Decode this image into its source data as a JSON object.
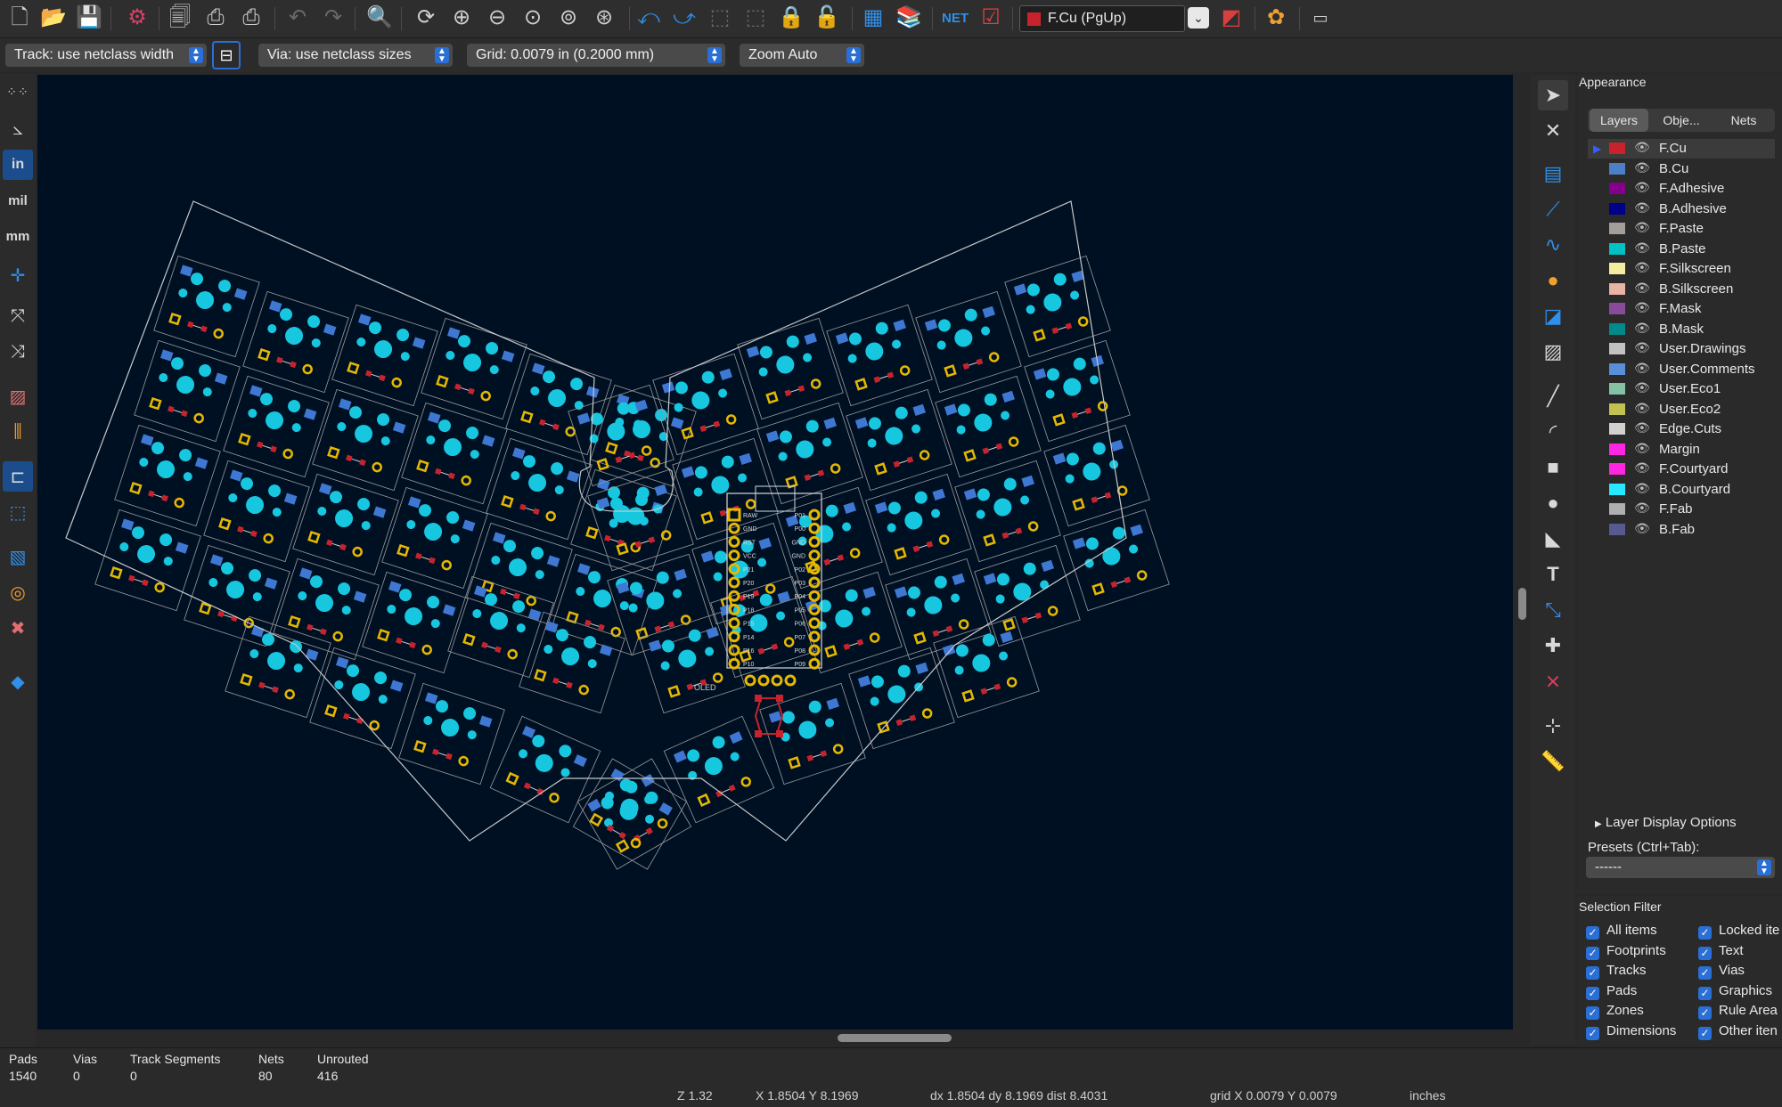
{
  "colors": {
    "canvas_bg": "#001023",
    "pad_cyan": "#17c7e0",
    "pad_blue": "#3f78d3",
    "pad_gold": "#e6b800",
    "pad_red": "#c8232c",
    "edge_cut": "#c8c8c8",
    "accent": "#2a6fd6"
  },
  "top_toolbar": {
    "active_layer": "F.Cu (PgUp)",
    "icons": [
      "new-board-icon",
      "open-icon",
      "save-icon",
      "board-setup-icon",
      "page-settings-icon",
      "print-icon",
      "plot-icon",
      "undo-icon",
      "redo-icon",
      "find-icon",
      "redraw-icon",
      "zoom-in-icon",
      "zoom-out-icon",
      "zoom-fit-icon",
      "zoom-objects-icon",
      "zoom-selection-icon",
      "rotate-ccw-icon",
      "rotate-cw-icon",
      "group-icon",
      "ungroup-icon",
      "lock-icon",
      "unlock-icon",
      "footprint-editor-icon",
      "footprint-library-icon",
      "netlist-icon",
      "drc-icon",
      "layer-pair-icon",
      "scripting-icon",
      "python-console-icon"
    ]
  },
  "sub_toolbar": {
    "track_width": "Track: use netclass width",
    "via_size": "Via: use netclass sizes",
    "grid": "Grid: 0.0079 in (0.2000 mm)",
    "zoom": "Zoom Auto"
  },
  "left_toolbar": {
    "units_in": "in",
    "units_mil": "mil",
    "units_mm": "mm"
  },
  "pcb": {
    "oled_label": "OLED",
    "mcu_left_pins": [
      "RAW",
      "GND",
      "RST",
      "VCC",
      "P21",
      "P20",
      "P19",
      "P18",
      "P15",
      "P14",
      "P16",
      "P10"
    ],
    "mcu_right_pins": [
      "P01",
      "P00",
      "GND",
      "GND",
      "P02",
      "P03",
      "P04",
      "P05",
      "P06",
      "P07",
      "P08",
      "P09"
    ]
  },
  "appearance": {
    "title": "Appearance",
    "tabs": [
      "Layers",
      "Obje...",
      "Nets"
    ],
    "layers": [
      {
        "name": "F.Cu",
        "color": "#c8232c"
      },
      {
        "name": "B.Cu",
        "color": "#4d7fc4"
      },
      {
        "name": "F.Adhesive",
        "color": "#84008a"
      },
      {
        "name": "B.Adhesive",
        "color": "#00008a"
      },
      {
        "name": "F.Paste",
        "color": "#a49e9a"
      },
      {
        "name": "B.Paste",
        "color": "#00c2c2"
      },
      {
        "name": "F.Silkscreen",
        "color": "#f2eda1"
      },
      {
        "name": "B.Silkscreen",
        "color": "#e8b2a7"
      },
      {
        "name": "F.Mask",
        "color": "#8a4a9a"
      },
      {
        "name": "B.Mask",
        "color": "#028a8a"
      },
      {
        "name": "User.Drawings",
        "color": "#c2c2c2"
      },
      {
        "name": "User.Comments",
        "color": "#598fd6"
      },
      {
        "name": "User.Eco1",
        "color": "#85c2a3"
      },
      {
        "name": "User.Eco2",
        "color": "#c2c252"
      },
      {
        "name": "Edge.Cuts",
        "color": "#d0d2cd"
      },
      {
        "name": "Margin",
        "color": "#ff26e2"
      },
      {
        "name": "F.Courtyard",
        "color": "#ff26e2"
      },
      {
        "name": "B.Courtyard",
        "color": "#26e9ff"
      },
      {
        "name": "F.Fab",
        "color": "#afafaf"
      },
      {
        "name": "B.Fab",
        "color": "#58598f"
      }
    ],
    "layer_display_options": "Layer Display Options",
    "presets_label": "Presets (Ctrl+Tab):",
    "presets_value": "------"
  },
  "selection_filter": {
    "title": "Selection Filter",
    "items_left": [
      "All items",
      "Footprints",
      "Tracks",
      "Pads",
      "Zones",
      "Dimensions"
    ],
    "items_right": [
      "Locked ite",
      "Text",
      "Vias",
      "Graphics",
      "Rule Area",
      "Other iten"
    ]
  },
  "status": {
    "pads_label": "Pads",
    "pads": "1540",
    "vias_label": "Vias",
    "vias": "0",
    "tracks_label": "Track Segments",
    "tracks": "0",
    "nets_label": "Nets",
    "nets": "80",
    "unrouted_label": "Unrouted",
    "unrouted": "416",
    "zoom": "Z 1.32",
    "xy": "X 1.8504  Y 8.1969",
    "delta": "dx 1.8504  dy 8.1969  dist 8.4031",
    "grid": "grid X 0.0079  Y 0.0079",
    "units": "inches"
  }
}
